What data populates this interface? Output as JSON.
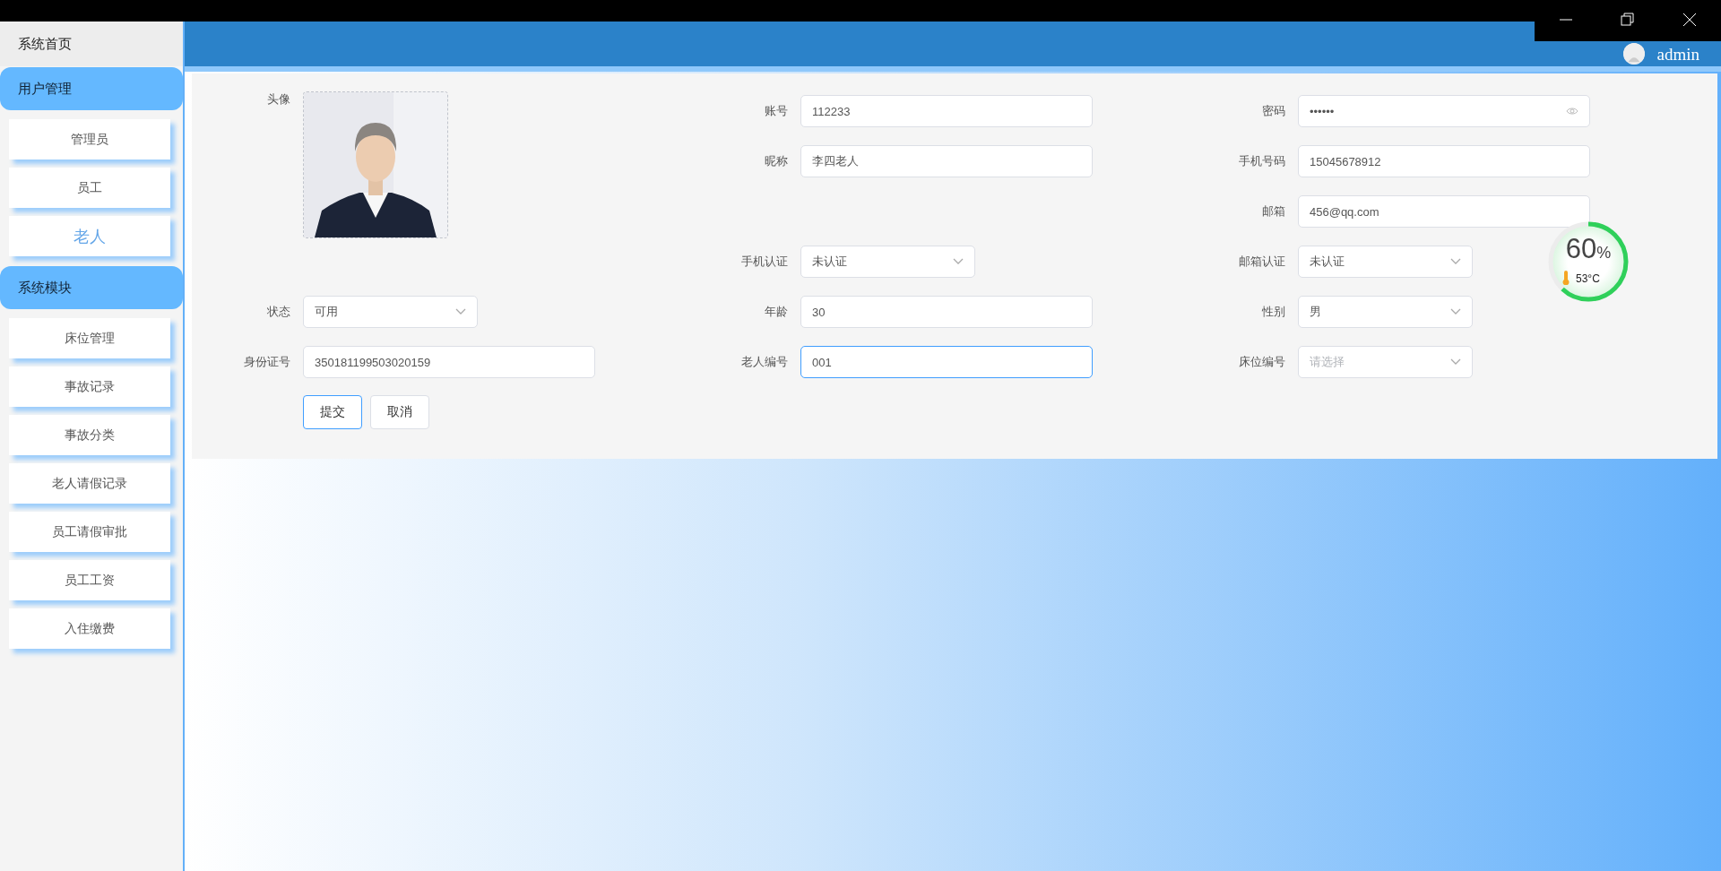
{
  "sidebar": {
    "home": "系统首页",
    "groups": [
      {
        "title": "用户管理",
        "items": [
          {
            "label": "管理员",
            "selected": false
          },
          {
            "label": "员工",
            "selected": false
          },
          {
            "label": "老人",
            "selected": true
          }
        ]
      },
      {
        "title": "系统模块",
        "items": [
          {
            "label": "床位管理",
            "selected": false
          },
          {
            "label": "事故记录",
            "selected": false
          },
          {
            "label": "事故分类",
            "selected": false
          },
          {
            "label": "老人请假记录",
            "selected": false
          },
          {
            "label": "员工请假审批",
            "selected": false
          },
          {
            "label": "员工工资",
            "selected": false
          },
          {
            "label": "入住缴费",
            "selected": false
          }
        ]
      }
    ]
  },
  "header": {
    "user": "admin"
  },
  "form": {
    "rows": [
      [
        {
          "label": "头像",
          "kind": "avatar"
        },
        {
          "label": "账号",
          "kind": "text",
          "value": "112233",
          "focused": false
        },
        {
          "label": "密码",
          "kind": "password",
          "value": "••••••",
          "focused": false
        }
      ],
      [
        "",
        {
          "label": "昵称",
          "kind": "text",
          "value": "李四老人",
          "focused": false
        },
        {
          "label": "手机号码",
          "kind": "text",
          "value": "15045678912",
          "focused": false
        }
      ],
      [
        "",
        "",
        {
          "label": "邮箱",
          "kind": "text",
          "value": "456@qq.com",
          "focused": false
        }
      ],
      [
        "",
        {
          "label": "手机认证",
          "kind": "select",
          "value": "未认证",
          "focused": false
        },
        {
          "label": "邮箱认证",
          "kind": "select",
          "value": "未认证",
          "focused": false
        }
      ],
      [
        {
          "label": "状态",
          "kind": "select",
          "value": "可用",
          "focused": false
        },
        {
          "label": "年龄",
          "kind": "text",
          "value": "30",
          "focused": false
        },
        {
          "label": "性别",
          "kind": "select",
          "value": "男",
          "focused": false
        }
      ],
      [
        {
          "label": "身份证号",
          "kind": "text",
          "value": "350181199503020159",
          "focused": false
        },
        {
          "label": "老人编号",
          "kind": "text",
          "value": "001",
          "focused": true
        },
        {
          "label": "床位编号",
          "kind": "select",
          "placeholder": "请选择",
          "focused": false
        }
      ]
    ],
    "buttons": [
      {
        "label": "提交",
        "kind": "primary"
      },
      {
        "label": "取消",
        "kind": "default"
      }
    ]
  },
  "monitor": {
    "level": 0.62,
    "value": "60",
    "unit": "%",
    "temperature": "53°C"
  }
}
